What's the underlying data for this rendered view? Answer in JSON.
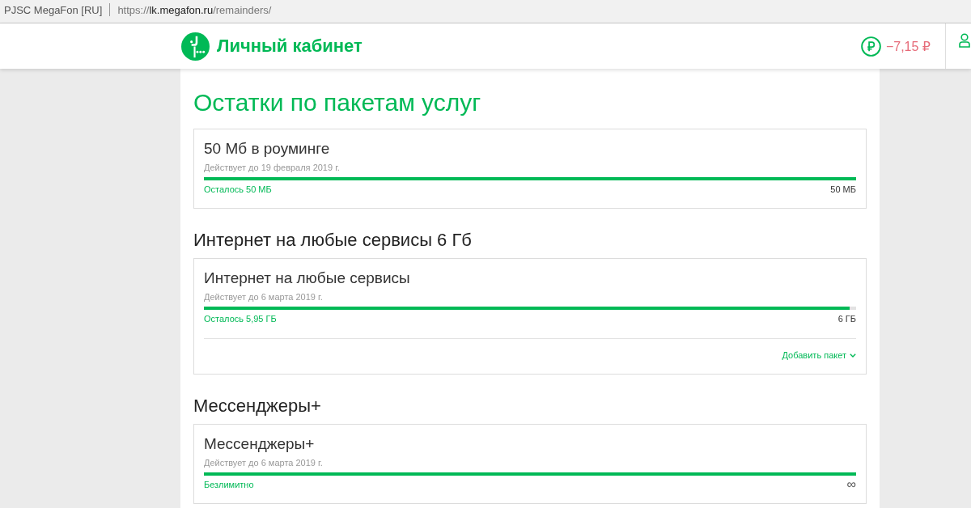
{
  "browser": {
    "tab_title": "PJSC MegaFon [RU]",
    "url": {
      "scheme": "https://",
      "host": "lk.megafon.ru",
      "path": "/remainders/"
    }
  },
  "header": {
    "title": "Личный кабинет",
    "balance": "−7,15 ₽"
  },
  "page_title": "Остатки по пакетам услуг",
  "groups": [
    {
      "cards": [
        {
          "title": "50 Мб в роуминге",
          "validity": "Действует до 19 февраля 2019 г.",
          "level": 1,
          "remaining": "Осталось 50 МБ",
          "total": "50 МБ"
        }
      ]
    },
    {
      "heading": "Интернет на любые сервисы 6 Гб",
      "cards": [
        {
          "title": "Интернет на любые сервисы",
          "validity": "Действует до 6 марта 2019 г.",
          "level": 0.99,
          "remaining": "Осталось 5,95 ГБ",
          "total": "6 ГБ",
          "action": "Добавить пакет"
        }
      ]
    },
    {
      "heading": "Мессенджеры+",
      "cards": [
        {
          "title": "Мессенджеры+",
          "validity": "Действует до 6 марта 2019 г.",
          "level": 1,
          "remaining": "Безлимитно",
          "total": "∞"
        }
      ]
    }
  ]
}
